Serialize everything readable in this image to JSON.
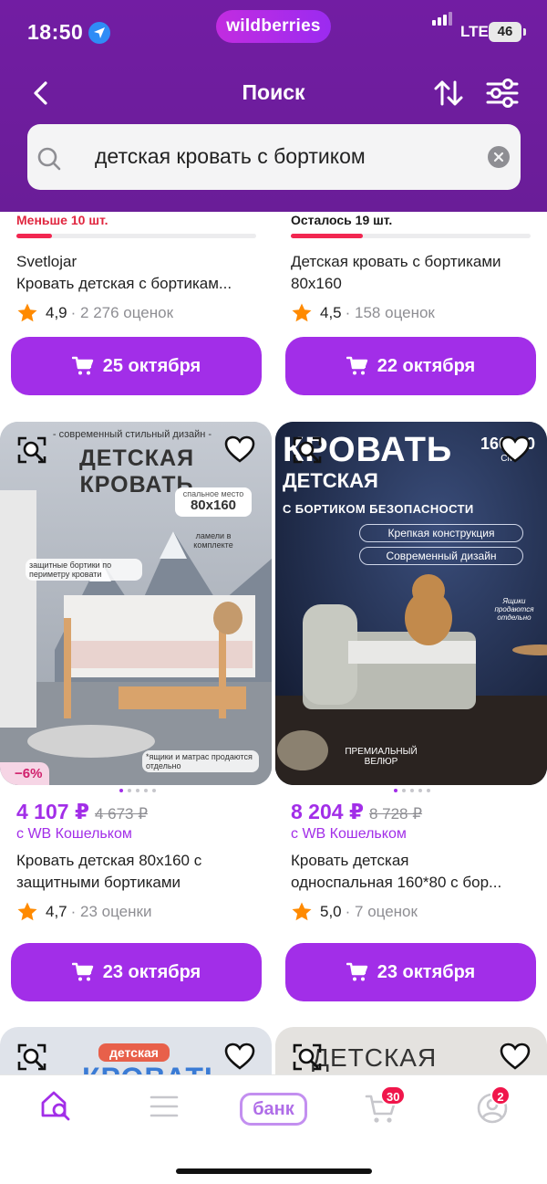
{
  "status": {
    "time": "18:50",
    "network": "LTE",
    "battery": "46"
  },
  "brand": "wildberries",
  "nav": {
    "title": "Поиск"
  },
  "search": {
    "query": "детская кровать с бортиком"
  },
  "colors": {
    "header": "#6d1f9c",
    "accent": "#a22ee8",
    "price": "#a22ee8",
    "sale_badge": "#d0206c",
    "star": "#ff8a00"
  },
  "row1": [
    {
      "stock": "Меньше 10 шт.",
      "stock_level": 0.15,
      "brand": "Svetlojar",
      "name": "Кровать детская с бортикам...",
      "rating": "4,9",
      "reviews": "· 2 276 оценок",
      "delivery": "25 октября"
    },
    {
      "stock": "Осталось 19 шт.",
      "stock_level": 0.3,
      "name": "Детская кровать с бортиками 80x160",
      "rating": "4,5",
      "reviews": "· 158 оценок",
      "delivery": "22 октября"
    }
  ],
  "row2": [
    {
      "photo_text": {
        "line1": "- современный стильный дизайн -",
        "headline": "ДЕТСКАЯ КРОВАТЬ",
        "size_label": "спальное место",
        "size": "80x160",
        "lamels": "ламели в комплекте",
        "bumpers": "защитные бортики по периметру кровати",
        "note": "*ящики и матрас продаются отдельно"
      },
      "discount": "−6%",
      "price": "4 107 ₽",
      "old_price": "4 673 ₽",
      "wallet": "с WB Кошельком",
      "name": "Кровать детская 80x160 с защитными бортиками",
      "rating": "4,7",
      "reviews": "· 23 оценки",
      "delivery": "23 октября"
    },
    {
      "photo_text": {
        "headline": "КРОВАТЬ",
        "sub": "ДЕТСКАЯ",
        "size": "160x80",
        "unit": "СМ",
        "safety": "С БОРТИКОМ БЕЗОПАСНОСТИ",
        "pill1": "Крепкая конструкция",
        "pill2": "Современный дизайн",
        "drawers": "Ящики продаются отдельно",
        "fabric": "ПРЕМИАЛЬНЫЙ ВЕЛЮР"
      },
      "price": "8 204 ₽",
      "old_price": "8 728 ₽",
      "wallet": "с WB Кошельком",
      "name": "Кровать детская односпальная 160*80 с бор...",
      "rating": "5,0",
      "reviews": "· 7 оценок",
      "delivery": "23 октября"
    }
  ],
  "row3": [
    {
      "photo_text": {
        "tag": "детская",
        "headline": "КРОВАТЬ"
      }
    },
    {
      "photo_text": {
        "headline": "ДЕТСКАЯ КРОВАТЬ"
      }
    }
  ],
  "tabbar": {
    "bank": "банк",
    "cart_count": "30",
    "profile_count": "2"
  },
  "icons": [
    "location-arrow-icon",
    "back-chevron-icon",
    "sort-icon",
    "filter-icon",
    "search-icon",
    "clear-icon",
    "star-icon",
    "cart-icon",
    "visual-search-icon",
    "heart-icon",
    "home-search-icon",
    "menu-icon",
    "bank-icon",
    "profile-icon"
  ]
}
